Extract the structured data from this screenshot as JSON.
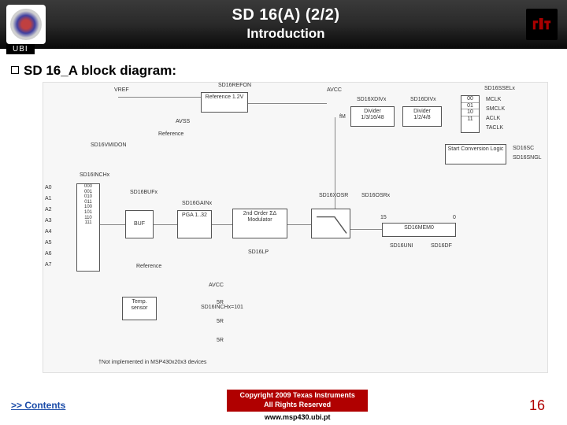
{
  "header": {
    "ubi": "UBI",
    "title": "SD 16(A) (2/2)",
    "subtitle": "Introduction",
    "ti_alt": "TI"
  },
  "body": {
    "bullet_text": "SD 16_A block diagram:"
  },
  "diagram": {
    "ref_block": "Reference\n1.2V",
    "ref_lbl": "Reference",
    "vref": "VREF",
    "avcc": "AVCC",
    "avss": "AVSS",
    "sd16refon": "SD16REFON",
    "sd16vmidon": "SD16VMIDON",
    "sd16xdivx": "SD16XDIVx",
    "sd16divx": "SD16DIVx",
    "sd16sselx": "SD16SSELx",
    "mclk": "MCLK",
    "smclk": "SMCLK",
    "aclk": "ACLK",
    "taclk": "TACLK",
    "sel00": "00",
    "sel01": "01",
    "sel10": "10",
    "sel11": "11",
    "divider1": "Divider\n1/3/16/48",
    "divider2": "Divider\n1/2/4/8",
    "fm": "fM",
    "start": "Start Conversion\nLogic",
    "sd16sc": "SD16SC",
    "sd16sngl": "SD16SNGL",
    "sd16inchx": "SD16INCHx",
    "a0": "A0",
    "a1": "A1",
    "a2": "A2",
    "a3": "A3",
    "a4": "A4",
    "a5": "A5",
    "a6": "A6",
    "a7": "A7",
    "mux000": "000",
    "mux001": "001",
    "mux010": "010",
    "mux011": "011",
    "mux100": "100",
    "mux101": "101",
    "mux110": "110",
    "mux111": "111",
    "sd16bufx": "SD16BUFx",
    "buf": "BUF",
    "sd16gainx": "SD16GAINx",
    "pga": "PGA\n1..32",
    "sd16osr": "SD16OSRx",
    "modulator": "2nd Order\nΣΔ Modulator",
    "sd16xosr": "SD16XOSR",
    "sd16mem": "SD16MEM0",
    "sd16lp": "SD16LP",
    "reference2": "Reference",
    "temp": "Temp.\nsensor",
    "sd16inchx101": "SD16INCHx=101",
    "avcc2": "AVCC",
    "r1": "5R",
    "r2": "5R",
    "r3": "5R",
    "fifteen": "15",
    "zero": "0",
    "sd16uni": "SD16UNI",
    "sd16df": "SD16DF",
    "footnote": "†Not implemented in MSP430x20x3 devices"
  },
  "footer": {
    "contents": ">> Contents",
    "copyright_line1": "Copyright 2009 Texas Instruments",
    "copyright_line2": "All Rights Reserved",
    "www": "www.msp430.ubi.pt",
    "slide_no": "16"
  }
}
